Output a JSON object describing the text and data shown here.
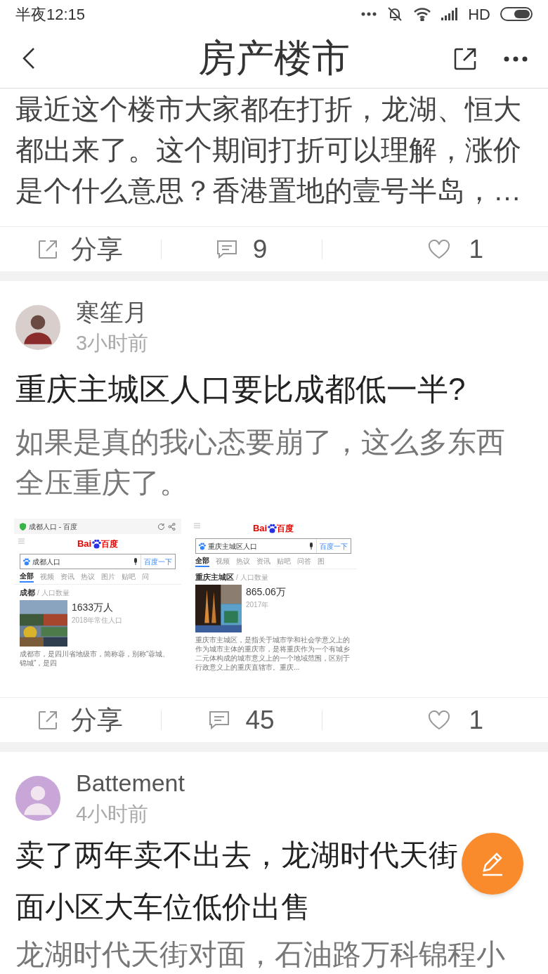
{
  "status_bar": {
    "time": "半夜12:15",
    "network": "HD"
  },
  "header": {
    "title": "房产楼市"
  },
  "posts": [
    {
      "snippet": "最近这个楼市大家都在打折，龙湖、恒大都出来了。这个期间打折可以理解，涨价是个什么意思？香港置地的壹号半岛，…",
      "actions": {
        "share": "分享",
        "comments": "9",
        "likes": "1"
      }
    },
    {
      "author": "寒笙月",
      "time": "3小时前",
      "title_lines": [
        "重庆主城区人口要比成都低一半?"
      ],
      "body": "如果是真的我心态要崩了，这么多东西全压重庆了。",
      "screenshots": [
        {
          "kind": "browser",
          "page_title": "成都人口 - 百度",
          "logo": [
            "Bai",
            "百度"
          ],
          "query": "成都人口",
          "search_button": "百度一下",
          "tabs": [
            {
              "label": "全部",
              "selected": true
            },
            {
              "label": "视频",
              "selected": false
            },
            {
              "label": "资讯",
              "selected": false
            },
            {
              "label": "热议",
              "selected": false
            },
            {
              "label": "图片",
              "selected": false
            },
            {
              "label": "贴吧",
              "selected": false
            },
            {
              "label": "问",
              "selected": false
            }
          ],
          "entity": "成都",
          "field": "/ 人口数量",
          "value": "1633万人",
          "note": "2018年常住人口",
          "desc": "成都市，是四川省地级市，简称蓉，别称“蓉城、锦城”，是四"
        },
        {
          "kind": "page",
          "logo": [
            "Bai",
            "百度"
          ],
          "query": "重庆主城区人口",
          "search_button": "百度一下",
          "tabs": [
            {
              "label": "全部",
              "selected": true
            },
            {
              "label": "视频",
              "selected": false
            },
            {
              "label": "热议",
              "selected": false
            },
            {
              "label": "资讯",
              "selected": false
            },
            {
              "label": "贴吧",
              "selected": false
            },
            {
              "label": "问答",
              "selected": false
            },
            {
              "label": "图",
              "selected": false
            }
          ],
          "entity": "重庆主城区",
          "field": "/ 人口数量",
          "value": "865.06万",
          "note": "2017年",
          "desc": "重庆市主城区，是指关于城市学和社会学意义上的作为城市主体的重庆市，是将重庆作为一个有城乡二元体构成的城市意义上的一个地域范围，区别于行政意义上的重庆直辖市。重庆..."
        }
      ],
      "actions": {
        "share": "分享",
        "comments": "45",
        "likes": "1"
      }
    },
    {
      "author": "Battement",
      "time": "4小时前",
      "title_lines": [
        "卖了两年卖不出去，龙湖时代天街",
        "面小区大车位低价出售"
      ],
      "body": "龙湖时代天街对面，石油路万科锦程小"
    }
  ]
}
